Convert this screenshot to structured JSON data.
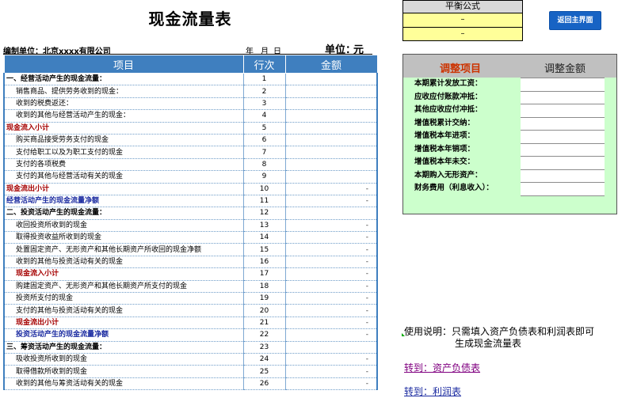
{
  "title": "现金流量表",
  "meta": {
    "company": "编制单位：北京xxxx有限公司",
    "year": "年",
    "month": "月",
    "day": "日",
    "unit_label": "单位：",
    "unit_value": "元"
  },
  "table": {
    "headers": [
      "项目",
      "行次",
      "金额"
    ],
    "rows": [
      {
        "label": "一、经营活动产生的现金流量：",
        "line": "1",
        "amount": "",
        "style": "sec"
      },
      {
        "label": "销售商品、提供劳务收到的现金：",
        "line": "2",
        "amount": "",
        "style": "ind"
      },
      {
        "label": "收到的税费返还：",
        "line": "3",
        "amount": "",
        "style": "ind"
      },
      {
        "label": "收到的其他与经营活动产生的现金：",
        "line": "4",
        "amount": "",
        "style": "ind"
      },
      {
        "label": "现金流入小计",
        "line": "5",
        "amount": "",
        "style": "red"
      },
      {
        "label": "购买商品接受劳务支付的现金",
        "line": "6",
        "amount": "",
        "style": "ind"
      },
      {
        "label": "支付给职工以及为职工支付的现金",
        "line": "7",
        "amount": "",
        "style": "ind"
      },
      {
        "label": "支付的各项税费",
        "line": "8",
        "amount": "",
        "style": "ind"
      },
      {
        "label": "支付的其他与经营活动有关的现金",
        "line": "9",
        "amount": "",
        "style": "ind"
      },
      {
        "label": "现金流出小计",
        "line": "10",
        "amount": "-",
        "style": "red"
      },
      {
        "label": "经营活动产生的现金流量净额",
        "line": "11",
        "amount": "-",
        "style": "blue"
      },
      {
        "label": "二、投资活动产生的现金流量：",
        "line": "12",
        "amount": "",
        "style": "sec"
      },
      {
        "label": "收回投资所收到的现金",
        "line": "13",
        "amount": "-",
        "style": "ind"
      },
      {
        "label": "取得投资收益所收到的现金",
        "line": "14",
        "amount": "-",
        "style": "ind"
      },
      {
        "label": "处置固定资产、无形资产和其他长期资产所收回的现金净额",
        "line": "15",
        "amount": "-",
        "style": "ind"
      },
      {
        "label": "收到的其他与投资活动有关的现金",
        "line": "16",
        "amount": "-",
        "style": "ind"
      },
      {
        "label": "现金流入小计",
        "line": "17",
        "amount": "-",
        "style": "red ind"
      },
      {
        "label": "购建固定资产、无形资产和其他长期资产所支付的现金",
        "line": "18",
        "amount": "-",
        "style": "ind"
      },
      {
        "label": "投资所支付的现金",
        "line": "19",
        "amount": "-",
        "style": "ind"
      },
      {
        "label": "支付的其他与投资活动有关的现金",
        "line": "20",
        "amount": "-",
        "style": "ind"
      },
      {
        "label": "现金流出小计",
        "line": "21",
        "amount": "-",
        "style": "red ind"
      },
      {
        "label": "投资活动产生的现金流量净额",
        "line": "22",
        "amount": "-",
        "style": "blue ind"
      },
      {
        "label": "三、筹资活动产生的现金流量：",
        "line": "23",
        "amount": "",
        "style": "sec"
      },
      {
        "label": "吸收投资所收到的现金",
        "line": "24",
        "amount": "-",
        "style": "ind"
      },
      {
        "label": "取得借款所收到的现金",
        "line": "25",
        "amount": "-",
        "style": "ind"
      },
      {
        "label": "收到的其他与筹资活动有关的现金",
        "line": "26",
        "amount": "-",
        "style": "ind"
      }
    ]
  },
  "formula": {
    "title": "平衡公式",
    "row1": "–",
    "row2": "–"
  },
  "return_button": "返回主界面",
  "adjust": {
    "header_item": "调整项目",
    "header_amount": "调整金额",
    "items": [
      "本期累计发放工资：",
      "应收应付账款冲抵：",
      "其他应收应付冲抵：",
      "增值税累计交纳：",
      "增值税本年进项：",
      "增值税本年销项：",
      "增值税本年未交：",
      "本期购入无形资产：",
      "财务费用（利息收入）："
    ]
  },
  "usage": {
    "line1": "使用说明：只需填入资产负债表和利润表即可",
    "line2": "生成现金流量表"
  },
  "links": {
    "balance_sheet": "转到：资产负债表",
    "income_statement": "转到：利润表"
  }
}
